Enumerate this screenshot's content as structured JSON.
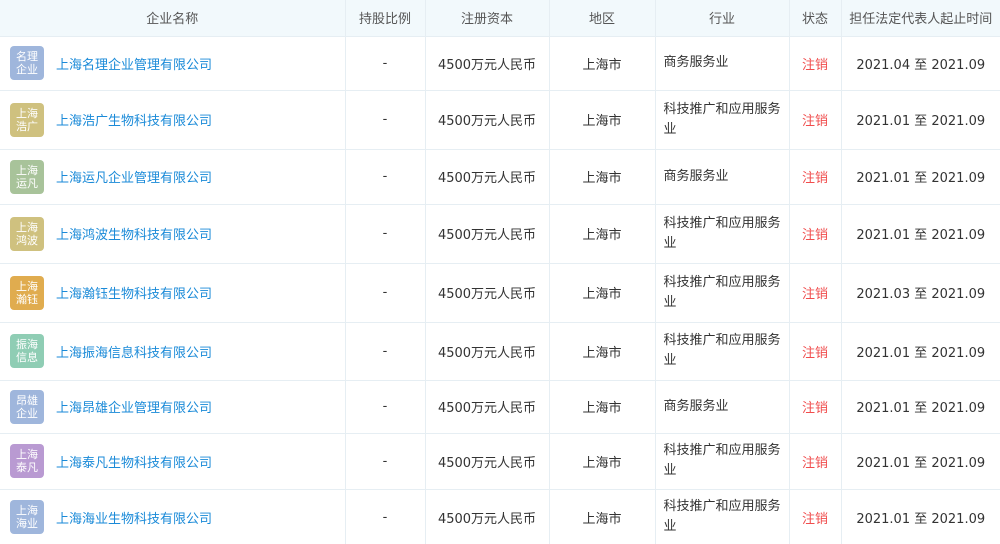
{
  "headers": {
    "company": "企业名称",
    "share": "持股比例",
    "capital": "注册资本",
    "region": "地区",
    "industry": "行业",
    "status": "状态",
    "period": "担任法定代表人起止时间"
  },
  "rows": [
    {
      "logo_line1": "名理",
      "logo_line2": "企业",
      "logo_color": "#9fb6dc",
      "company": "上海名理企业管理有限公司",
      "share": "-",
      "capital": "4500万元人民币",
      "region": "上海市",
      "industry": "商务服务业",
      "status": "注销",
      "period": "2021.04 至 2021.09"
    },
    {
      "logo_line1": "上海",
      "logo_line2": "浩广",
      "logo_color": "#cfc17f",
      "company": "上海浩广生物科技有限公司",
      "share": "-",
      "capital": "4500万元人民币",
      "region": "上海市",
      "industry": "科技推广和应用服务业",
      "status": "注销",
      "period": "2021.01 至 2021.09"
    },
    {
      "logo_line1": "上海",
      "logo_line2": "运凡",
      "logo_color": "#a8c39a",
      "company": "上海运凡企业管理有限公司",
      "share": "-",
      "capital": "4500万元人民币",
      "region": "上海市",
      "industry": "商务服务业",
      "status": "注销",
      "period": "2021.01 至 2021.09"
    },
    {
      "logo_line1": "上海",
      "logo_line2": "鸿波",
      "logo_color": "#cfc17f",
      "company": "上海鸿波生物科技有限公司",
      "share": "-",
      "capital": "4500万元人民币",
      "region": "上海市",
      "industry": "科技推广和应用服务业",
      "status": "注销",
      "period": "2021.01 至 2021.09"
    },
    {
      "logo_line1": "上海",
      "logo_line2": "瀚钰",
      "logo_color": "#e0ac4f",
      "company": "上海瀚钰生物科技有限公司",
      "share": "-",
      "capital": "4500万元人民币",
      "region": "上海市",
      "industry": "科技推广和应用服务业",
      "status": "注销",
      "period": "2021.03 至 2021.09"
    },
    {
      "logo_line1": "振海",
      "logo_line2": "信息",
      "logo_color": "#8fcdb4",
      "company": "上海振海信息科技有限公司",
      "share": "-",
      "capital": "4500万元人民币",
      "region": "上海市",
      "industry": "科技推广和应用服务业",
      "status": "注销",
      "period": "2021.01 至 2021.09"
    },
    {
      "logo_line1": "昂雄",
      "logo_line2": "企业",
      "logo_color": "#9fb6dc",
      "company": "上海昂雄企业管理有限公司",
      "share": "-",
      "capital": "4500万元人民币",
      "region": "上海市",
      "industry": "商务服务业",
      "status": "注销",
      "period": "2021.01 至 2021.09"
    },
    {
      "logo_line1": "上海",
      "logo_line2": "泰凡",
      "logo_color": "#b99ad2",
      "company": "上海泰凡生物科技有限公司",
      "share": "-",
      "capital": "4500万元人民币",
      "region": "上海市",
      "industry": "科技推广和应用服务业",
      "status": "注销",
      "period": "2021.01 至 2021.09"
    },
    {
      "logo_line1": "上海",
      "logo_line2": "海业",
      "logo_color": "#9fb6dc",
      "company": "上海海业生物科技有限公司",
      "share": "-",
      "capital": "4500万元人民币",
      "region": "上海市",
      "industry": "科技推广和应用服务业",
      "status": "注销",
      "period": "2021.01 至 2021.09"
    }
  ]
}
